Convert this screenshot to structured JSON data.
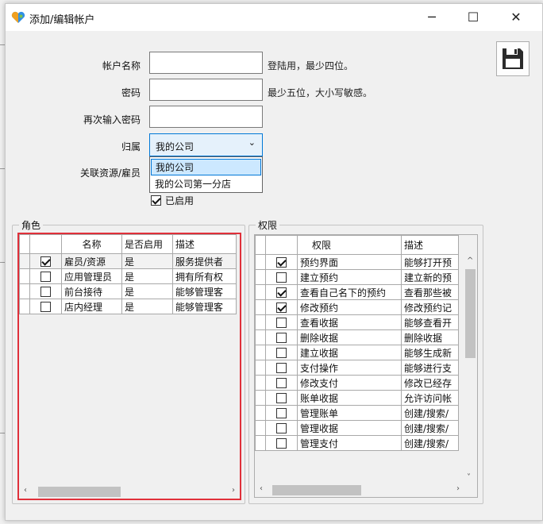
{
  "window": {
    "title": "添加/编辑帐户"
  },
  "form": {
    "account_name_label": "帐户名称",
    "account_name_value": "",
    "account_name_hint": "登陆用，最少四位。",
    "password_label": "密码",
    "password_value": "",
    "password_hint": "最少五位，大小写敏感。",
    "repeat_password_label": "再次输入密码",
    "repeat_password_value": "",
    "belongs_label": "归属",
    "belongs_value": "我的公司",
    "belongs_options": [
      "我的公司",
      "我的公司第一分店"
    ],
    "related_label": "关联资源/雇员",
    "enabled_label": "已启用",
    "enabled_checked": true
  },
  "roles": {
    "title": "角色",
    "columns": [
      "名称",
      "是否启用",
      "描述"
    ],
    "rows": [
      {
        "checked": true,
        "name": "雇员/资源",
        "enabled": "是",
        "desc": "服务提供者"
      },
      {
        "checked": false,
        "name": "应用管理员",
        "enabled": "是",
        "desc": "拥有所有权"
      },
      {
        "checked": false,
        "name": "前台接待",
        "enabled": "是",
        "desc": "能够管理客"
      },
      {
        "checked": false,
        "name": "店内经理",
        "enabled": "是",
        "desc": "能够管理客"
      }
    ]
  },
  "permissions": {
    "title": "权限",
    "columns": [
      "权限",
      "描述"
    ],
    "rows": [
      {
        "checked": true,
        "name": "预约界面",
        "desc": "能够打开预"
      },
      {
        "checked": false,
        "name": "建立预约",
        "desc": "建立新的预"
      },
      {
        "checked": true,
        "name": "查看自己名下的预约",
        "desc": "查看那些被"
      },
      {
        "checked": true,
        "name": "修改预约",
        "desc": "修改预约记"
      },
      {
        "checked": false,
        "name": "查看收据",
        "desc": "能够查看开"
      },
      {
        "checked": false,
        "name": "删除收据",
        "desc": "删除收据"
      },
      {
        "checked": false,
        "name": "建立收据",
        "desc": "能够生成新"
      },
      {
        "checked": false,
        "name": "支付操作",
        "desc": "能够进行支"
      },
      {
        "checked": false,
        "name": "修改支付",
        "desc": "修改已经存"
      },
      {
        "checked": false,
        "name": "账单收据",
        "desc": "允许访问帐"
      },
      {
        "checked": false,
        "name": "管理账单",
        "desc": "创建/搜索/"
      },
      {
        "checked": false,
        "name": "管理收据",
        "desc": "创建/搜索/"
      },
      {
        "checked": false,
        "name": "管理支付",
        "desc": "创建/搜索/"
      }
    ]
  },
  "colors": {
    "accent": "#0078d7",
    "selection": "#cce8ff",
    "roles_border": "#e0303a"
  }
}
